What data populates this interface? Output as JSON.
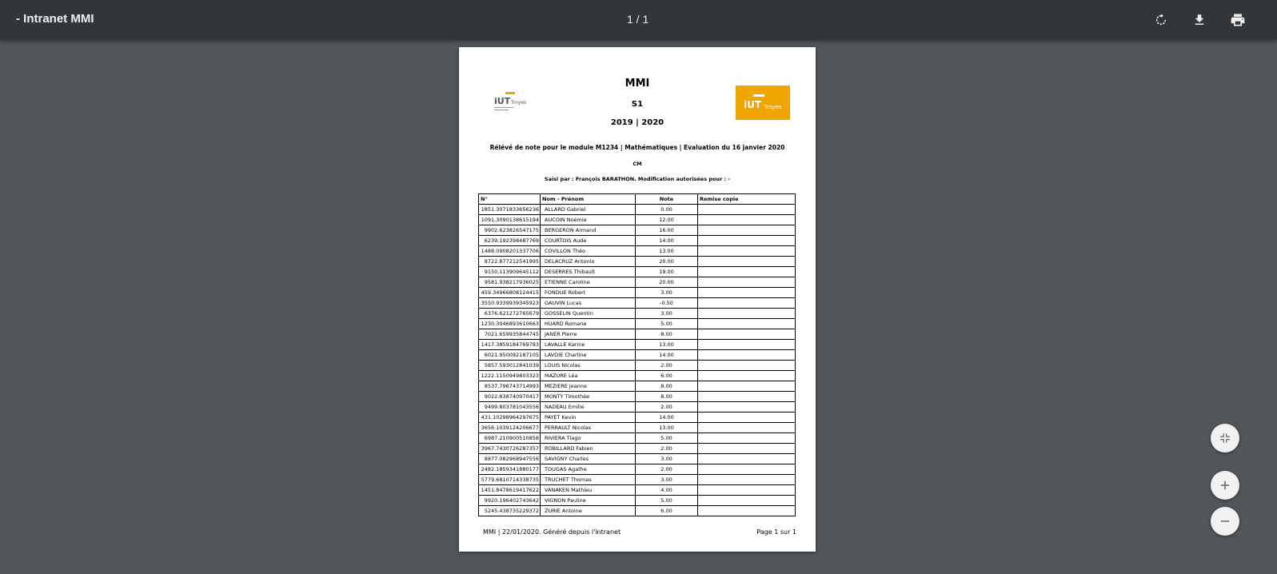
{
  "toolbar": {
    "title": "- Intranet MMI",
    "page_indicator": "1 / 1"
  },
  "colors": {
    "toolbar_bg": "#323639",
    "viewer_bg": "#525659",
    "logo_accent": "#f0a500"
  },
  "icons": {
    "rotate": "rotate-icon",
    "download": "download-icon",
    "print": "print-icon",
    "fit": "fit-to-page-icon",
    "zoom_in": "plus-icon",
    "zoom_out": "minus-icon"
  },
  "document": {
    "logos": {
      "text": "IUT Troyes"
    },
    "heading": "MMI",
    "semester": "S1",
    "year": "2019 | 2020",
    "subtitle": "Rélévé de note pour le module M1234 | Mathématiques | Evaluation du 16 janvier 2020",
    "type": "CM",
    "entered_by": "Saisi par : François BARATHON. Modification autorisées pour : -",
    "table": {
      "headers": [
        "N°",
        "Nom - Prénom",
        "Note",
        "Remise copie"
      ],
      "rows": [
        [
          "1851.3071833656236",
          "ALLARD Gabriel",
          "0.00",
          ""
        ],
        [
          "1091.3090138615194",
          "AUCOIN Noémie",
          "12.00",
          ""
        ],
        [
          "9902.623826547175",
          "BERGERON Armand",
          "16.00",
          ""
        ],
        [
          "6239.192398487769",
          "COURTOIS Aude",
          "14.00",
          ""
        ],
        [
          "1488.0908201337706",
          "COVILLON Théo",
          "13.00",
          ""
        ],
        [
          "8722.877212541995",
          "DELACRUZ Antonio",
          "20.00",
          ""
        ],
        [
          "9150.113909645112",
          "DESERRES Thibault",
          "19.00",
          ""
        ],
        [
          "9581.938217936025",
          "ETIENNE Caroline",
          "20.00",
          ""
        ],
        [
          "459.34966808124415",
          "FONDUE Robert",
          "3.00",
          ""
        ],
        [
          "3550.9339939345923",
          "GAUVIN Lucas",
          "-0.50",
          ""
        ],
        [
          "6376.621272765679",
          "GOSSELIN Quentin",
          "3.00",
          ""
        ],
        [
          "1230.3046893610663",
          "HUARD Romane",
          "5.00",
          ""
        ],
        [
          "7021.659935844745",
          "JANER Pierre",
          "8.00",
          ""
        ],
        [
          "1417.3859184769783",
          "LAVALLE Karine",
          "13.00",
          ""
        ],
        [
          "6021.950092187105",
          "LAVOIE Charline",
          "14.00",
          ""
        ],
        [
          "5857.593012841039",
          "LOUIS Nicolas",
          "2.00",
          ""
        ],
        [
          "1222.1150949803323",
          "MAZURE Léa",
          "6.00",
          ""
        ],
        [
          "8537.796743714993",
          "MEZIERE Jeanne",
          "8.00",
          ""
        ],
        [
          "9022.638740970417",
          "MONTY Timothée",
          "8.00",
          ""
        ],
        [
          "9499.803781043556",
          "NADEAU Emilie",
          "2.00",
          ""
        ],
        [
          "431.10298964297675",
          "PAYET Kevin",
          "14.00",
          ""
        ],
        [
          "3656.1039124206677",
          "PERRAULT Nicolas",
          "13.00",
          ""
        ],
        [
          "6987.210900510858",
          "RIVIERA Tiago",
          "5.00",
          ""
        ],
        [
          "3967.7430726287357",
          "ROBILLARD Fabien",
          "2.00",
          ""
        ],
        [
          "8877.082968947556",
          "SAVIGNY Charles",
          "3.00",
          ""
        ],
        [
          "2482.1859341880177",
          "TOUGAS Agathe",
          "2.00",
          ""
        ],
        [
          "5779.6810714338735",
          "TRUCHET Thomas",
          "3.00",
          ""
        ],
        [
          "1451.8478619417622",
          "VANAKEN Mathieu",
          "4.00",
          ""
        ],
        [
          "9920.196402743642",
          "VIGNON Pauline",
          "5.00",
          ""
        ],
        [
          "5245.438735229372",
          "ZURIE Antoine",
          "6.00",
          ""
        ]
      ]
    },
    "footer_left": "MMI | 22/01/2020. Généré depuis l'intranet",
    "footer_right": "Page 1 sur 1"
  }
}
